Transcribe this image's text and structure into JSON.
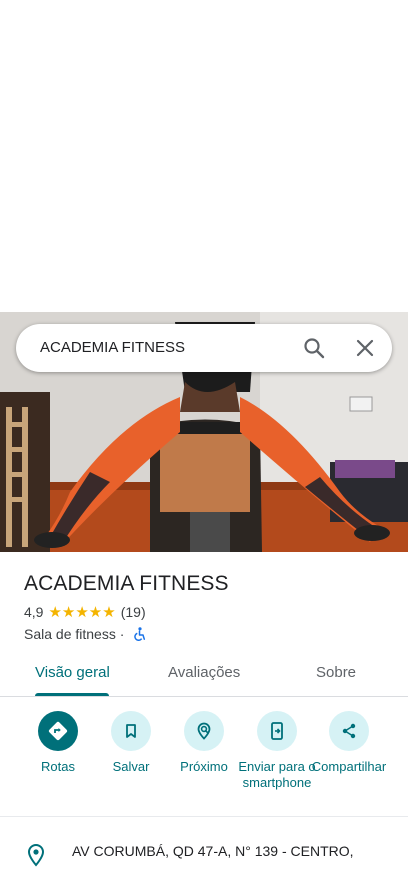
{
  "search": {
    "query": "ACADEMIA FITNESS"
  },
  "place": {
    "name": "ACADEMIA FITNESS",
    "rating": "4,9",
    "stars": "★★★★★",
    "review_count": "(19)",
    "category": "Sala de fitness",
    "separator": " · ",
    "address": "AV CORUMBÁ, QD 47-A, N° 139 - CENTRO,"
  },
  "tabs": [
    {
      "label": "Visão geral",
      "active": true
    },
    {
      "label": "Avaliações",
      "active": false
    },
    {
      "label": "Sobre",
      "active": false
    }
  ],
  "actions": [
    {
      "label": "Rotas",
      "icon": "directions-icon"
    },
    {
      "label": "Salvar",
      "icon": "bookmark-icon"
    },
    {
      "label": "Próximo",
      "icon": "nearby-icon"
    },
    {
      "label": "Enviar para o smartphone",
      "icon": "send-to-phone-icon"
    },
    {
      "label": "Compartilhar",
      "icon": "share-icon"
    }
  ],
  "colors": {
    "accent": "#00707a",
    "accent_light": "#d6f2f5",
    "star": "#f4b400",
    "text": "#202124"
  }
}
